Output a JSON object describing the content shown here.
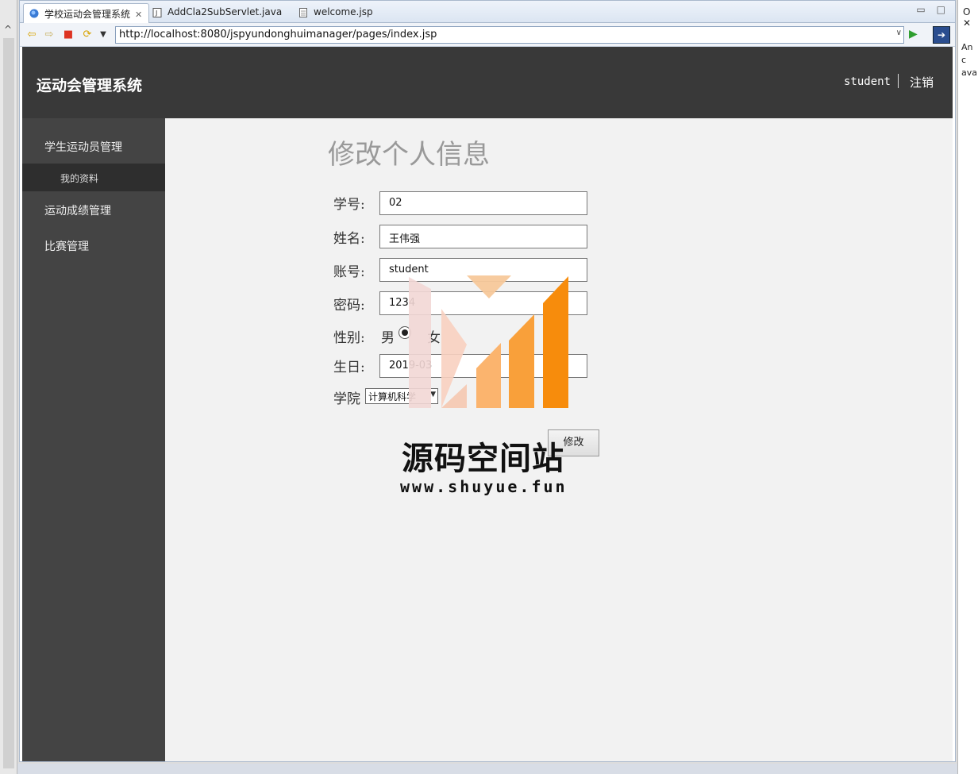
{
  "ide": {
    "tabs": [
      {
        "label": "学校运动会管理系统",
        "close": "✕"
      },
      {
        "label": "AddCla2SubServlet.java"
      },
      {
        "label": "welcome.jsp"
      }
    ],
    "url": "http://localhost:8080/jspyundonghuimanager/pages/index.jsp",
    "right_pane_title": "O ✕",
    "right_pane_text": "An c ava"
  },
  "app": {
    "brand": "运动会管理系统",
    "user": "student",
    "logout": "注销"
  },
  "sidebar": {
    "items": [
      {
        "label": "学生运动员管理"
      },
      {
        "label": "我的资料"
      },
      {
        "label": "运动成绩管理"
      },
      {
        "label": "比赛管理"
      }
    ]
  },
  "form": {
    "title": "修改个人信息",
    "student_id_label": "学号:",
    "student_id": "02",
    "name_label": "姓名:",
    "name": "王伟强",
    "account_label": "账号:",
    "account": "student",
    "password_label": "密码:",
    "password": "1234",
    "gender_label": "性别:",
    "gender_male": "男",
    "gender_female": "女",
    "birthday_label": "生日:",
    "birthday": "2019-03",
    "college_label": "学院",
    "college": "计算机科学",
    "submit": "修改"
  },
  "watermark": {
    "line1": "源码空间站",
    "line2": "www.shuyue.fun"
  }
}
